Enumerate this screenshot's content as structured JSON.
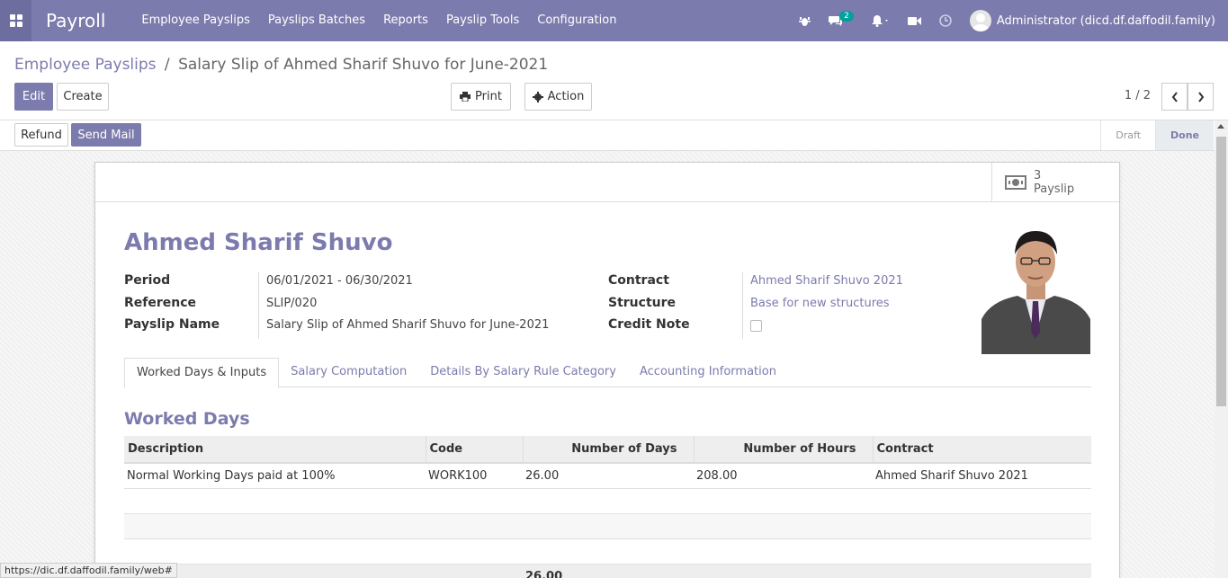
{
  "navbar": {
    "app_title": "Payroll",
    "menu": [
      "Employee Payslips",
      "Payslips Batches",
      "Reports",
      "Payslip Tools",
      "Configuration"
    ],
    "messages_count": "2",
    "user_label": "Administrator (dicd.df.daffodil.family)"
  },
  "breadcrumb": {
    "parent": "Employee Payslips",
    "separator": "/",
    "current": "Salary Slip of Ahmed Sharif Shuvo for June-2021"
  },
  "buttons": {
    "edit": "Edit",
    "create": "Create",
    "print": "Print",
    "action": "Action",
    "refund": "Refund",
    "send_mail": "Send Mail"
  },
  "pager": {
    "value": "1 / 2"
  },
  "stages": [
    "Draft",
    "Done"
  ],
  "active_stage": "Done",
  "smart_button": {
    "count": "3",
    "label": "Payslip"
  },
  "employee": {
    "name": "Ahmed Sharif Shuvo"
  },
  "fields": {
    "period_label": "Period",
    "period_value": "06/01/2021 - 06/30/2021",
    "reference_label": "Reference",
    "reference_value": "SLIP/020",
    "payslip_name_label": "Payslip Name",
    "payslip_name_value": "Salary Slip of Ahmed Sharif Shuvo for June-2021",
    "contract_label": "Contract",
    "contract_value": "Ahmed Sharif Shuvo 2021",
    "structure_label": "Structure",
    "structure_value": "Base for new structures",
    "credit_note_label": "Credit Note",
    "credit_note_checked": false
  },
  "tabs": [
    "Worked Days & Inputs",
    "Salary Computation",
    "Details By Salary Rule Category",
    "Accounting Information"
  ],
  "worked_days": {
    "title": "Worked Days",
    "columns": [
      "Description",
      "Code",
      "Number of Days",
      "Number of Hours",
      "Contract"
    ],
    "rows": [
      [
        "Normal Working Days paid at 100%",
        "WORK100",
        "26.00",
        "208.00",
        "Ahmed Sharif Shuvo 2021"
      ]
    ],
    "total_days": "26.00"
  },
  "status_url": "https://dic.df.daffodil.family/web#",
  "colors": {
    "brand": "#7c7bad",
    "accent_badge": "#00a09d"
  }
}
